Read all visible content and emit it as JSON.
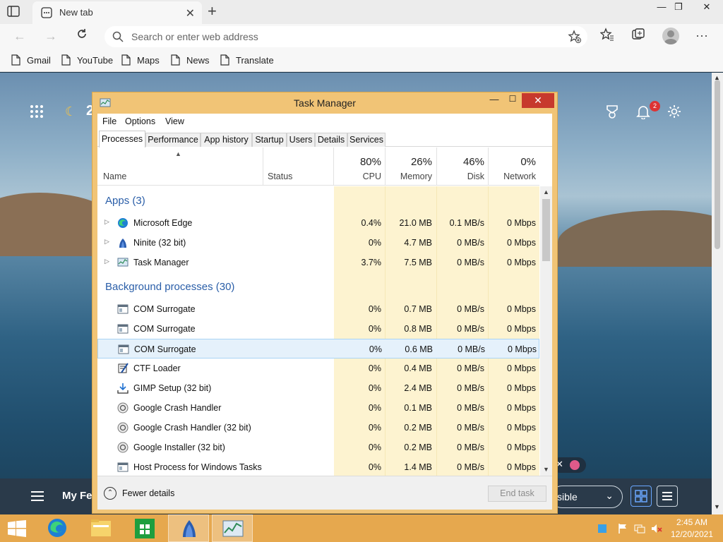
{
  "browser": {
    "tab_title": "New tab",
    "tab_close": "✕",
    "new_tab": "+",
    "address_placeholder": "Search or enter web address",
    "window_min": "—",
    "window_max": "❐",
    "window_close": "✕",
    "bookmarks": [
      "Gmail",
      "YouTube",
      "Maps",
      "News",
      "Translate"
    ]
  },
  "newtab_page": {
    "temperature": "2",
    "notification_count": "2",
    "my_feed": "My Fe",
    "visibility_label": "sible"
  },
  "task_manager": {
    "title": "Task Manager",
    "menu": [
      "File",
      "Options",
      "View"
    ],
    "tabs": [
      "Processes",
      "Performance",
      "App history",
      "Startup",
      "Users",
      "Details",
      "Services"
    ],
    "active_tab": "Processes",
    "columns": {
      "name": "Name",
      "status": "Status",
      "cpu_pct": "80%",
      "cpu": "CPU",
      "memory_pct": "26%",
      "memory": "Memory",
      "disk_pct": "46%",
      "disk": "Disk",
      "network_pct": "0%",
      "network": "Network"
    },
    "sections": {
      "apps": "Apps (3)",
      "background": "Background processes (30)"
    },
    "apps": [
      {
        "name": "Microsoft Edge",
        "cpu": "0.4%",
        "memory": "21.0 MB",
        "disk": "0.1 MB/s",
        "network": "0 Mbps",
        "icon": "edge-icon"
      },
      {
        "name": "Ninite (32 bit)",
        "cpu": "0%",
        "memory": "4.7 MB",
        "disk": "0 MB/s",
        "network": "0 Mbps",
        "icon": "ninite-icon"
      },
      {
        "name": "Task Manager",
        "cpu": "3.7%",
        "memory": "7.5 MB",
        "disk": "0 MB/s",
        "network": "0 Mbps",
        "icon": "task-manager-icon"
      }
    ],
    "background": [
      {
        "name": "COM Surrogate",
        "cpu": "0%",
        "memory": "0.7 MB",
        "disk": "0 MB/s",
        "network": "0 Mbps",
        "icon": "window-icon"
      },
      {
        "name": "COM Surrogate",
        "cpu": "0%",
        "memory": "0.8 MB",
        "disk": "0 MB/s",
        "network": "0 Mbps",
        "icon": "window-icon"
      },
      {
        "name": "COM Surrogate",
        "cpu": "0%",
        "memory": "0.6 MB",
        "disk": "0 MB/s",
        "network": "0 Mbps",
        "icon": "window-icon"
      },
      {
        "name": "CTF Loader",
        "cpu": "0%",
        "memory": "0.4 MB",
        "disk": "0 MB/s",
        "network": "0 Mbps",
        "icon": "ctf-icon"
      },
      {
        "name": "GIMP Setup (32 bit)",
        "cpu": "0%",
        "memory": "2.4 MB",
        "disk": "0 MB/s",
        "network": "0 Mbps",
        "icon": "installer-icon"
      },
      {
        "name": "Google Crash Handler",
        "cpu": "0%",
        "memory": "0.1 MB",
        "disk": "0 MB/s",
        "network": "0 Mbps",
        "icon": "google-update-icon"
      },
      {
        "name": "Google Crash Handler (32 bit)",
        "cpu": "0%",
        "memory": "0.2 MB",
        "disk": "0 MB/s",
        "network": "0 Mbps",
        "icon": "google-update-icon"
      },
      {
        "name": "Google Installer (32 bit)",
        "cpu": "0%",
        "memory": "0.2 MB",
        "disk": "0 MB/s",
        "network": "0 Mbps",
        "icon": "google-update-icon"
      },
      {
        "name": "Host Process for Windows Tasks",
        "cpu": "0%",
        "memory": "1.4 MB",
        "disk": "0 MB/s",
        "network": "0 Mbps",
        "icon": "window-icon"
      }
    ],
    "selected_row": 2,
    "fewer_details": "Fewer details",
    "end_task": "End task"
  },
  "taskbar": {
    "time": "2:45 AM",
    "date": "12/20/2021"
  },
  "colors": {
    "taskbar": "#e6a84e",
    "window_frame": "#f1c476",
    "heat_cell": "#fdf3d0",
    "section_blue": "#2a5ea8"
  }
}
